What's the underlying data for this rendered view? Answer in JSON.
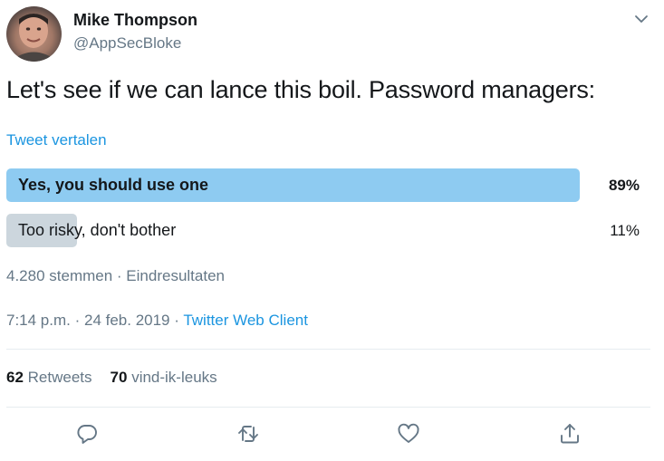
{
  "author": {
    "display_name": "Mike Thompson",
    "handle": "@AppSecBloke"
  },
  "tweet": {
    "text": "Let's see if we can lance this boil. Password managers:",
    "translate_label": "Tweet vertalen"
  },
  "poll": {
    "options": [
      {
        "label": "Yes, you should use one",
        "percent_label": "89%",
        "percent": 89,
        "winner": true
      },
      {
        "label": "Too risky, don't bother",
        "percent_label": "11%",
        "percent": 11,
        "winner": false
      }
    ],
    "votes": "4.280 stemmen",
    "separator": " · ",
    "status": "Eindresultaten",
    "winner_color": "#8ecbf1",
    "other_color": "#ccd6dd"
  },
  "meta": {
    "time": "7:14 p.m.",
    "date": "24 feb. 2019",
    "separator": " · ",
    "source": "Twitter Web Client"
  },
  "stats": {
    "retweets_count": "62",
    "retweets_label": "Retweets",
    "likes_count": "70",
    "likes_label": "vind-ik-leuks"
  },
  "actions": [
    {
      "name": "reply-icon"
    },
    {
      "name": "retweet-icon"
    },
    {
      "name": "like-icon"
    },
    {
      "name": "share-icon"
    }
  ],
  "colors": {
    "link": "#1b95e0",
    "secondary_text": "#657786",
    "primary_text": "#14171a",
    "icon": "#657786",
    "divider": "#e6ecf0"
  }
}
